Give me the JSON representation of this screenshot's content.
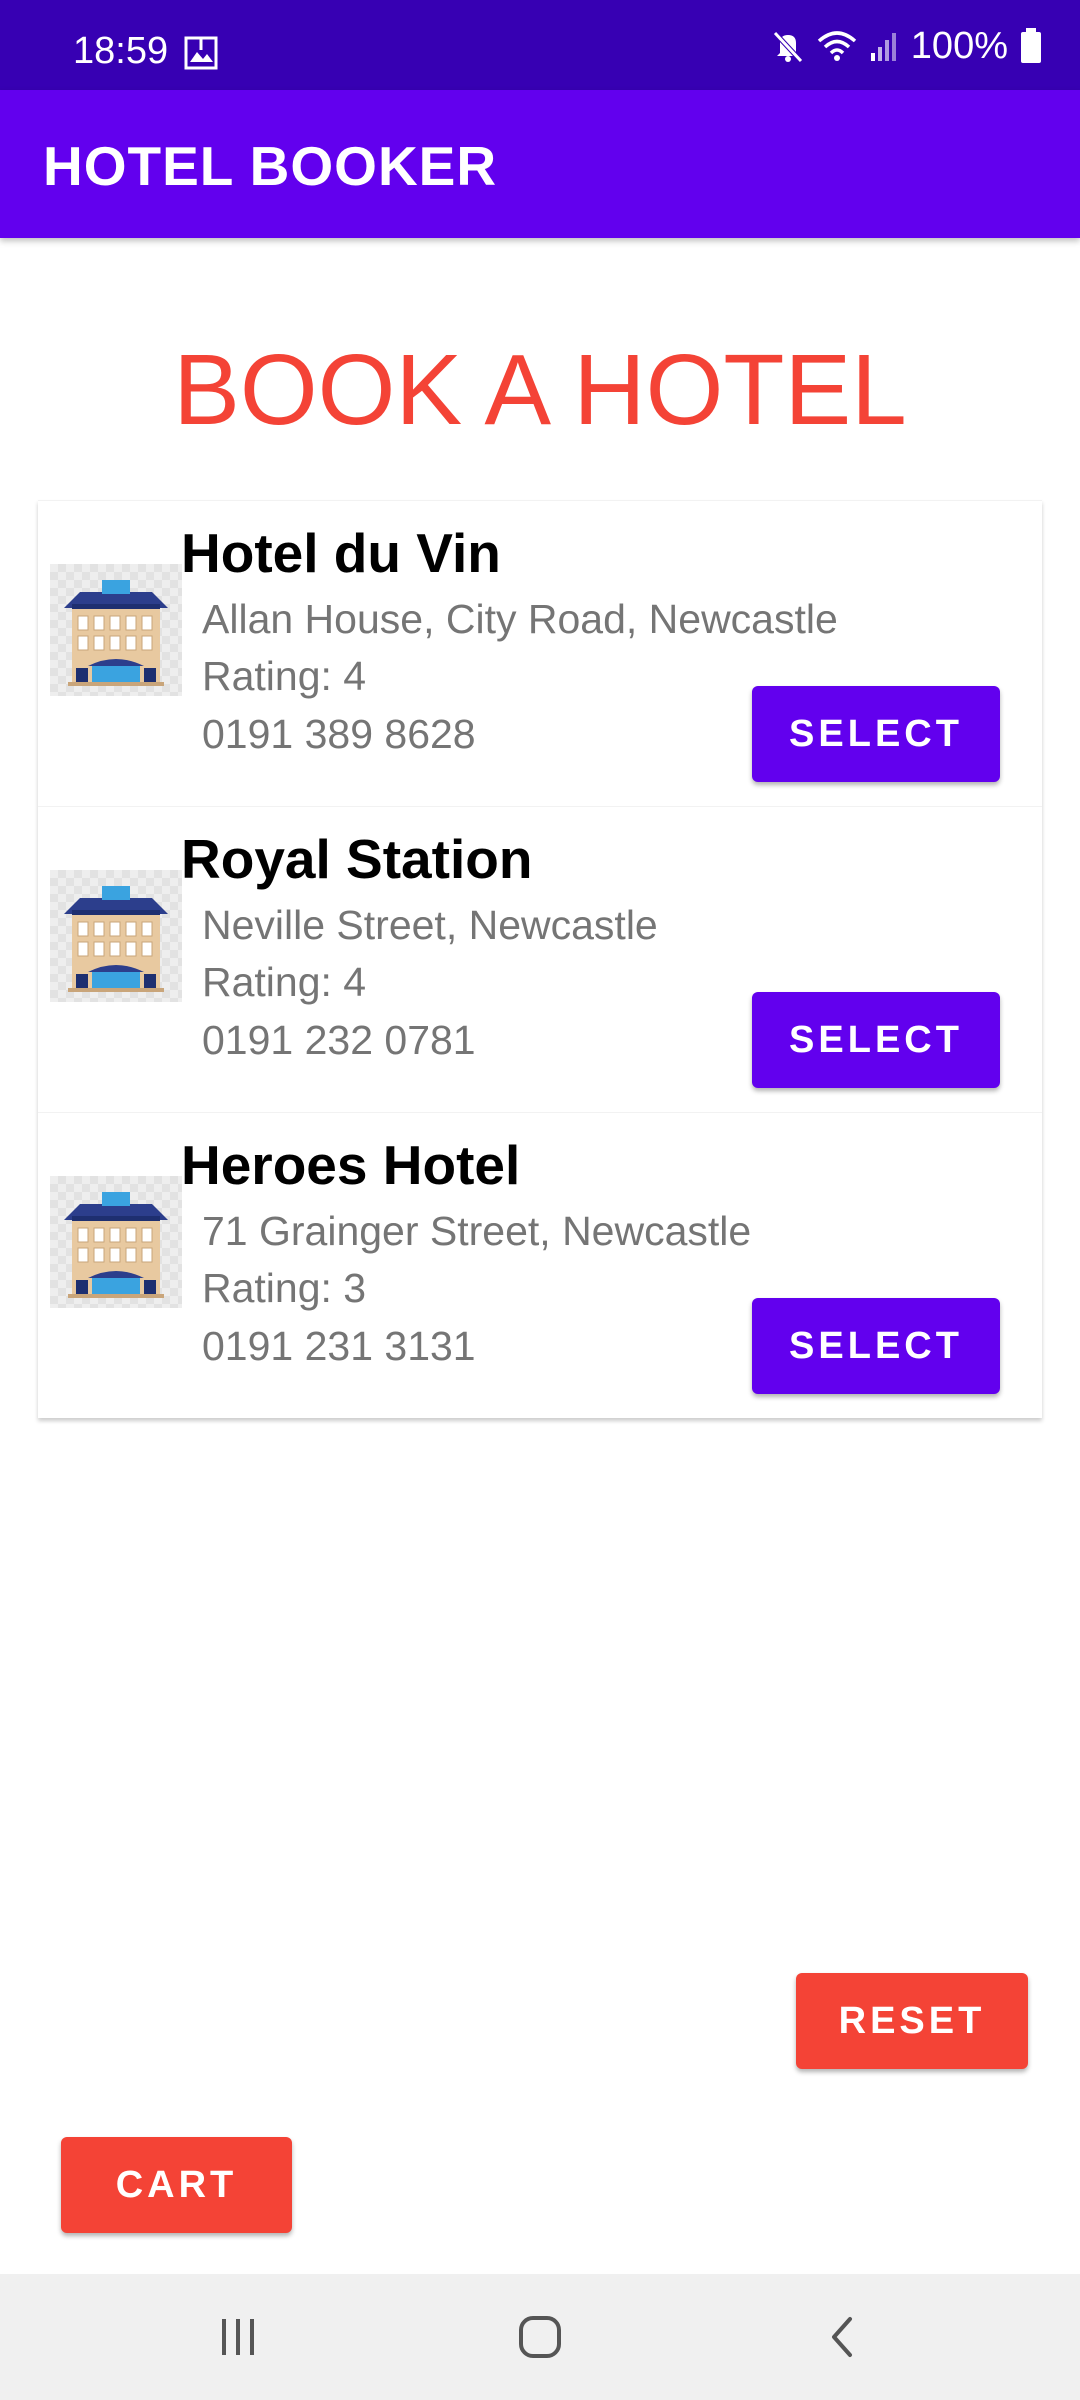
{
  "status_bar": {
    "time": "18:59",
    "battery": "100%",
    "icons": [
      "gallery-icon",
      "mute-icon",
      "wifi-icon",
      "signal-icon",
      "battery-icon"
    ]
  },
  "app_bar": {
    "title": "HOTEL BOOKER",
    "color": "#6200ee"
  },
  "page": {
    "heading": "BOOK A HOTEL",
    "heading_color": "#f44336"
  },
  "hotels": [
    {
      "name": "Hotel du Vin",
      "address": "Allan House, City Road, Newcastle",
      "rating": "Rating: 4",
      "phone": "0191 389 8628",
      "button": "SELECT",
      "icon": "hotel-building-icon"
    },
    {
      "name": "Royal Station",
      "address": "Neville Street, Newcastle",
      "rating": "Rating: 4",
      "phone": "0191 232 0781",
      "button": "SELECT",
      "icon": "hotel-building-icon"
    },
    {
      "name": "Heroes Hotel",
      "address": "71 Grainger Street, Newcastle",
      "rating": "Rating: 3",
      "phone": "0191 231 3131",
      "button": "SELECT",
      "icon": "hotel-building-icon"
    }
  ],
  "actions": {
    "reset": "RESET",
    "cart": "CART",
    "accent_color": "#f44336"
  },
  "nav_bar": {
    "icons": [
      "recent-apps-icon",
      "home-icon",
      "back-icon"
    ]
  }
}
